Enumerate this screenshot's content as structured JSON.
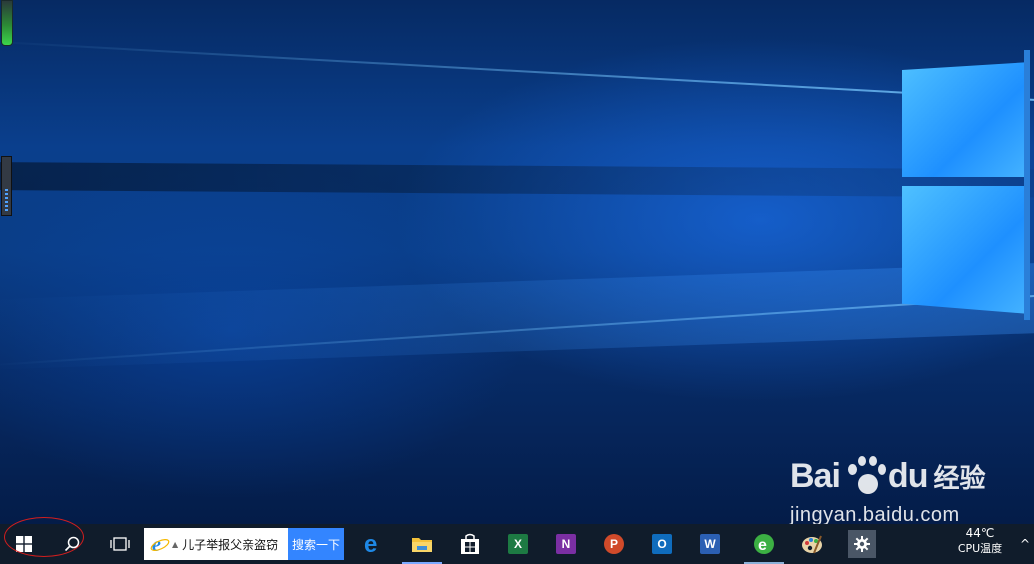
{
  "desktop": {
    "wallpaper": "windows-10-hero-light",
    "colors": {
      "sky": "#0a3f8d",
      "glow": "#4fc1ff"
    }
  },
  "watermark": {
    "brand_left": "Bai",
    "brand_right": "du",
    "brand_cn": "经验",
    "url": "jingyan.baidu.com"
  },
  "taskbar": {
    "background": "#101c2b",
    "start_icon": "windows-logo-icon",
    "search_icon": "search-icon",
    "taskview_icon": "task-view-icon",
    "searchbox": {
      "query": "儿子举报父亲盗窃",
      "button_label": "搜索一下",
      "icon": "ie-icon"
    },
    "apps": [
      {
        "name": "edge",
        "icon": "edge-icon",
        "color": "#1e88e5"
      },
      {
        "name": "file-explorer",
        "icon": "folder-icon",
        "color": "#f3c13a"
      },
      {
        "name": "store",
        "icon": "store-icon",
        "color": "#ffffff"
      },
      {
        "name": "excel",
        "icon": "excel-icon",
        "letter": "X",
        "color": "#1d7a43"
      },
      {
        "name": "onenote",
        "icon": "onenote-icon",
        "letter": "N",
        "color": "#7b2fa3"
      },
      {
        "name": "powerpoint",
        "icon": "powerpoint-icon",
        "letter": "P",
        "color": "#d04a2a"
      },
      {
        "name": "outlook",
        "icon": "outlook-icon",
        "letter": "O",
        "color": "#0f6cbd"
      },
      {
        "name": "word",
        "icon": "word-icon",
        "letter": "W",
        "color": "#2b5fb3"
      },
      {
        "name": "browser",
        "icon": "green-browser-icon",
        "color": "#3cb043"
      },
      {
        "name": "paint",
        "icon": "paint-palette-icon",
        "color": "#c8a064"
      },
      {
        "name": "settings",
        "icon": "gear-icon",
        "color": "#ffffff"
      }
    ],
    "tray": {
      "temperature": "44℃",
      "temperature_label": "CPU温度",
      "chevron": "^"
    }
  }
}
